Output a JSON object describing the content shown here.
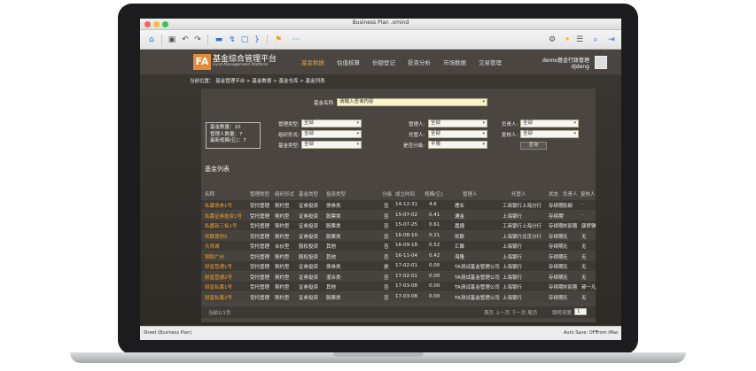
{
  "window": {
    "title": "Business Plan .xmind"
  },
  "statusbar": {
    "left": "Sheet (Business Plan)",
    "autosave": "Auto Save: OFF",
    "source": "from iMac"
  },
  "app": {
    "logo_mark": "FA",
    "logo_cn": "基金综合管理平台",
    "logo_en": "Fund Management Platform",
    "nav": [
      "基金数据",
      "估值核算",
      "份额登记",
      "投资分析",
      "市场数据",
      "交易管理"
    ],
    "user_line1": "demo基金行政管理",
    "user_line2": "djdeng"
  },
  "breadcrumb": {
    "label": "当前位置：",
    "items": [
      "基金管理平台",
      ">",
      "基金数据",
      ">",
      "基金仓库",
      ">",
      "基金列表"
    ]
  },
  "search": {
    "label": "基金名称:",
    "placeholder": "请输入查询内容"
  },
  "summary": {
    "count": "基金数量：10",
    "managers": "管理人数量：7",
    "scale": "最新规模(亿)：7"
  },
  "filters": {
    "manage_type_label": "管理类型:",
    "manage_type_value": "全部",
    "org_form_label": "组织形式:",
    "org_form_value": "全部",
    "fund_type_label": "基金类型:",
    "fund_type_value": "全部",
    "manager_label": "管理人:",
    "manager_value": "全部",
    "custodian_label": "托管人:",
    "custodian_value": "全部",
    "graded_label": "是否分级:",
    "graded_value": "不限",
    "owner_label": "负责人:",
    "owner_value": "全部",
    "reviewer_label": "复核人:",
    "reviewer_value": "全部",
    "query_button": "查询"
  },
  "section_title": "基金列表",
  "table": {
    "headers": [
      "名称",
      "管理类型",
      "组织形式",
      "基金类型",
      "投资类型",
      "分级",
      "成立时间",
      "规模(亿)",
      "管理人",
      "托管人",
      "状态",
      "负责人",
      "复核人"
    ],
    "rows": [
      [
        "私募债券1号",
        "受托管理",
        "契约型",
        "证券投资",
        "债券类",
        "否",
        "14-12-31",
        "4.6",
        "理业",
        "工商银行上海分行",
        "存续期",
        "张颖",
        "-"
      ],
      [
        "私募证券投资1号",
        "受托管理",
        "契约型",
        "证券投资",
        "股票类",
        "否",
        "15-07-02",
        "0.41",
        "通金",
        "上海银行",
        "存续期",
        "-",
        "-"
      ],
      [
        "私募新三板1号",
        "受托管理",
        "契约型",
        "证券投资",
        "股票类",
        "否",
        "15-07-25",
        "0.61",
        "嘉捷",
        "工商银行上海分行",
        "存续期",
        "刘丽蓉",
        "康梦雅"
      ],
      [
        "凯联尊悦5",
        "受托管理",
        "契约型",
        "证券投资",
        "股票类",
        "否",
        "16-08-10",
        "0.21",
        "凯联",
        "上海银行北京分行",
        "存续期",
        "无",
        "无"
      ],
      [
        "共青城",
        "受托管理",
        "合伙型",
        "股权投资",
        "其他",
        "否",
        "16-09-18",
        "0.52",
        "汇聚",
        "上海银行",
        "存续期",
        "无",
        "无"
      ],
      [
        "铜和广州",
        "受托管理",
        "契约型",
        "股权投资",
        "其他",
        "否",
        "16-11-04",
        "0.42",
        "海隆",
        "上海银行",
        "存续期",
        "无",
        "无"
      ],
      [
        "财富营通1号",
        "受托管理",
        "契约型",
        "证券投资",
        "债券类",
        "是",
        "17-02-01",
        "0.00",
        "TA测试基金管理公司",
        "上海银行",
        "存续期",
        "无",
        "无"
      ],
      [
        "财富营通2号",
        "受托管理",
        "契约型",
        "证券投资",
        "混合类",
        "否",
        "17-02-01",
        "0.00",
        "TA测试基金管理公司",
        "上海银行",
        "存续期",
        "无",
        "无"
      ],
      [
        "财富私募1号",
        "受托管理",
        "契约型",
        "证券投资",
        "其他",
        "否",
        "17-03-08",
        "0.00",
        "TA测试基金管理公司",
        "上海银行",
        "存续期",
        "刘丽蓉",
        "郝一凡"
      ],
      [
        "财富私募2号",
        "受托管理",
        "契约型",
        "证券投资",
        "股票类",
        "否",
        "17-03-08",
        "0.00",
        "TA测试基金管理公司",
        "上海银行",
        "存续期",
        "无",
        "无"
      ]
    ]
  },
  "pagination": {
    "info": "当前1/1页",
    "nav": "首页 上一页 下一页 尾页",
    "goto": "跳转到第",
    "page": "1"
  }
}
